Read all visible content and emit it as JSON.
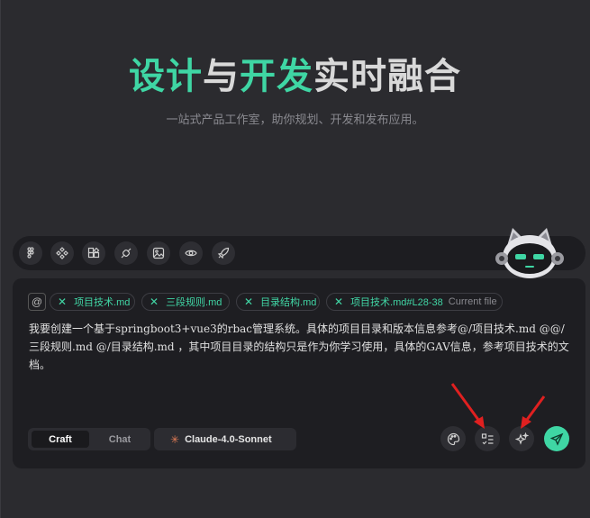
{
  "hero": {
    "title_part1": "设计",
    "title_part2": "与",
    "title_part3": "开发",
    "title_part4": "实时融合",
    "subtitle": "一站式产品工作室，助你规划、开发和发布应用。"
  },
  "toolbar": {
    "icons": [
      "figma-icon",
      "components-icon",
      "widgets-icon",
      "plug-icon",
      "image-icon",
      "eye-icon",
      "rocket-icon"
    ]
  },
  "composer": {
    "at_symbol": "@",
    "chips": [
      {
        "label": "项目技术.md"
      },
      {
        "label": "三段规则.md"
      },
      {
        "label": "目录结构.md"
      },
      {
        "label": "项目技术.md#L28-38",
        "suffix": "Current file"
      }
    ],
    "message": "我要创建一个基于springboot3+vue3的rbac管理系统。具体的项目目录和版本信息参考@/项目技术.md @@/三段规则.md @/目录结构.md ，其中项目目录的结构只是作为你学习使用，具体的GAV信息，参考项目技术的文档。",
    "mode_craft": "Craft",
    "mode_chat": "Chat",
    "active_mode": "Craft",
    "model": "Claude-4.0-Sonnet"
  },
  "colors": {
    "accent": "#3fd6a4",
    "background": "#2b2b2f",
    "panel": "#1e1e22",
    "annotation_arrow": "#e02020"
  }
}
